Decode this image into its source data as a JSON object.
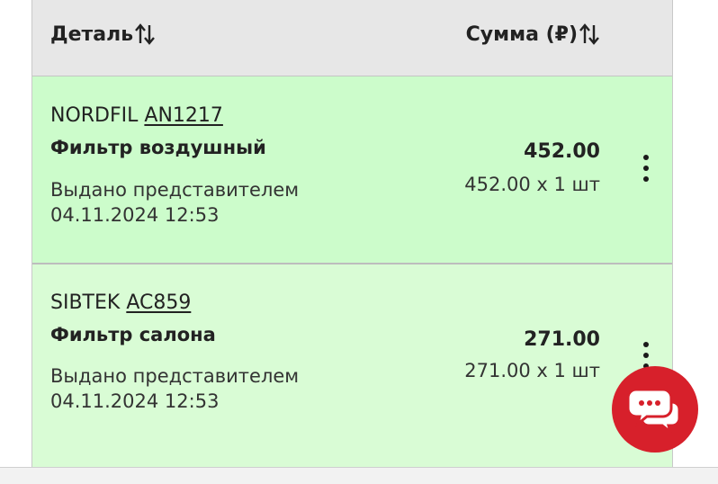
{
  "table": {
    "headers": {
      "detail": "Деталь",
      "sum": "Сумма (₽)"
    },
    "rows": [
      {
        "brand": "NORDFIL",
        "article": "AN1217",
        "name": "Фильтр воздушный",
        "status": "Выдано представителем",
        "datetime": "04.11.2024 12:53",
        "price": "452.00",
        "qty_line": "452.00 х 1 шт"
      },
      {
        "brand": "SIBTEK",
        "article": "AC859",
        "name": "Фильтр салона",
        "status": "Выдано представителем",
        "datetime": "04.11.2024 12:53",
        "price": "271.00",
        "qty_line": "271.00 х 1 шт"
      }
    ]
  },
  "icons": {
    "sort": "sort-arrows-icon",
    "menu": "kebab-menu-icon",
    "chat": "chat-bubbles-icon"
  },
  "colors": {
    "row_bg": "#d9fcd5",
    "header_bg": "#e7e7e7",
    "chat_button": "#d7202b"
  }
}
